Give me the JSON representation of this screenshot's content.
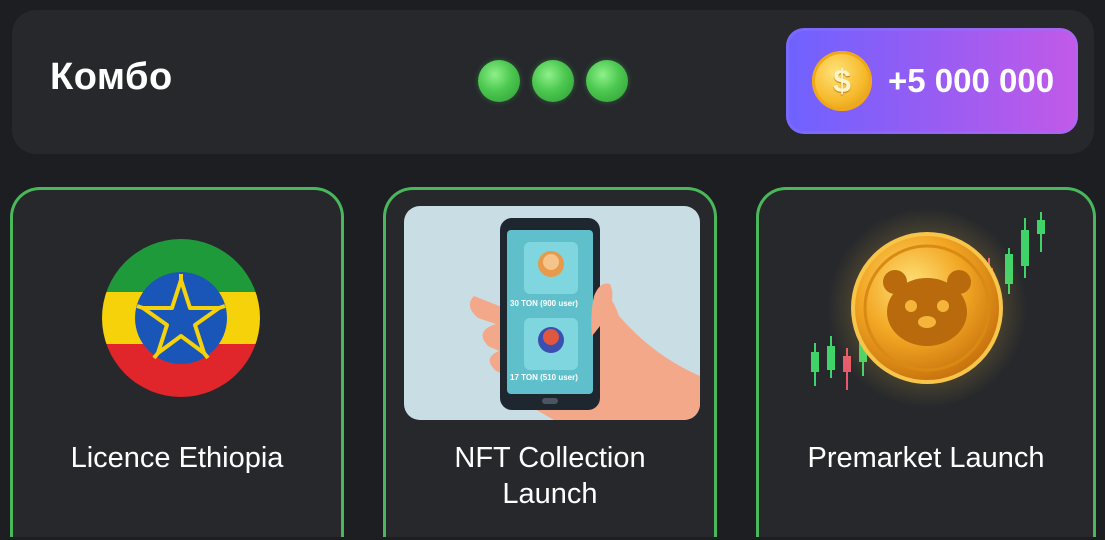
{
  "combo": {
    "title": "Комбо",
    "found_count": 3,
    "reward": "+5 000 000",
    "coin_symbol": "$"
  },
  "cards": [
    {
      "label": "Licence Ethiopia",
      "icon": "ethiopia-flag-icon"
    },
    {
      "label": "NFT Collection\nLaunch",
      "icon": "phone-nft-icon",
      "image_labels": [
        "30 TON (900 user)",
        "17 TON (510 user)"
      ]
    },
    {
      "label": "Premarket Launch",
      "icon": "hamster-coin-icon"
    }
  ],
  "colors": {
    "background": "#1c1e21",
    "panel": "#26282c",
    "card_border": "#49b85a",
    "reward_gradient_start": "#6e62ff",
    "reward_gradient_end": "#c25ae8",
    "dot_green": "#4cc850"
  }
}
